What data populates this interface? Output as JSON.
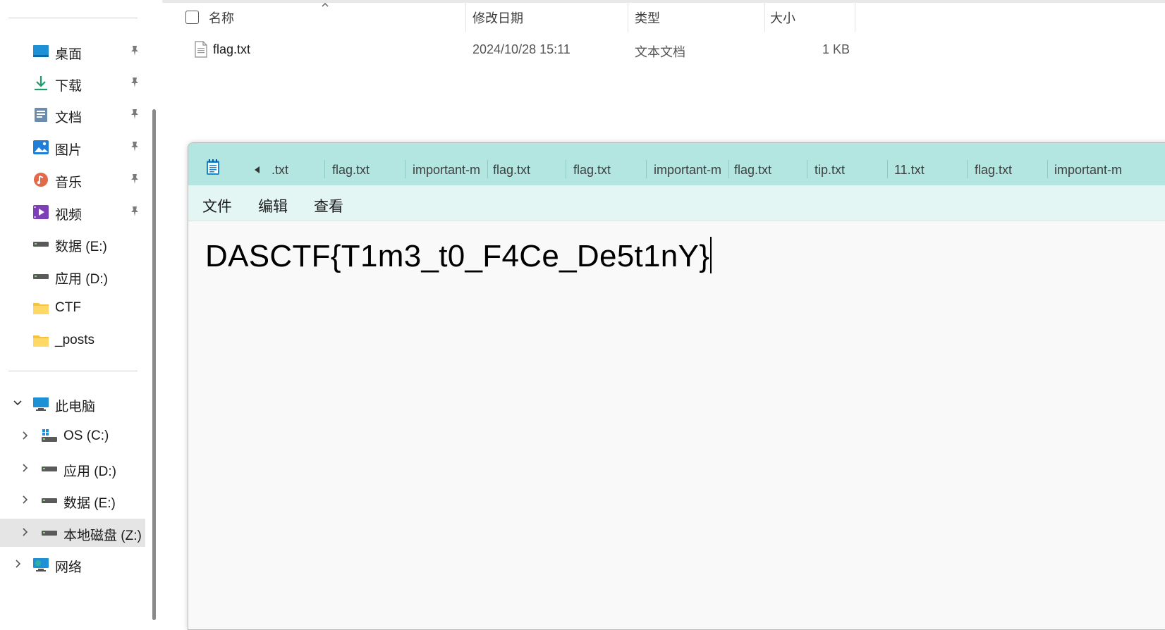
{
  "nav": {
    "quick_access": [
      {
        "label": "桌面",
        "icon": "desktop-icon"
      },
      {
        "label": "下载",
        "icon": "download-icon"
      },
      {
        "label": "文档",
        "icon": "documents-icon"
      },
      {
        "label": "图片",
        "icon": "pictures-icon"
      },
      {
        "label": "音乐",
        "icon": "music-icon"
      },
      {
        "label": "视频",
        "icon": "videos-icon"
      },
      {
        "label": "数据 (E:)",
        "icon": "drive-icon"
      },
      {
        "label": "应用 (D:)",
        "icon": "drive-icon"
      },
      {
        "label": "CTF",
        "icon": "folder-icon"
      },
      {
        "label": "_posts",
        "icon": "folder-icon"
      }
    ],
    "this_pc": {
      "label": "此电脑",
      "icon": "computer-icon"
    },
    "drives": [
      {
        "label": "OS (C:)",
        "icon": "windows-drive-icon"
      },
      {
        "label": "应用 (D:)",
        "icon": "drive-icon"
      },
      {
        "label": "数据 (E:)",
        "icon": "drive-icon"
      },
      {
        "label": "本地磁盘 (Z:)",
        "icon": "drive-icon",
        "selected": true
      }
    ],
    "network": {
      "label": "网络",
      "icon": "network-icon"
    }
  },
  "file_list": {
    "columns": {
      "name": "名称",
      "date": "修改日期",
      "type": "类型",
      "size": "大小"
    },
    "rows": [
      {
        "name": "flag.txt",
        "date": "2024/10/28 15:11",
        "type": "文本文档",
        "size": "1 KB"
      }
    ]
  },
  "notepad": {
    "tabs": [
      ".txt",
      "flag.txt",
      "important-m",
      "flag.txt",
      "flag.txt",
      "important-m",
      "flag.txt",
      "tip.txt",
      "11.txt",
      "flag.txt",
      "important-m"
    ],
    "menu": {
      "file": "文件",
      "edit": "编辑",
      "view": "查看"
    },
    "content": "DASCTF{T1m3_t0_F4Ce_De5t1nY}"
  },
  "colors": {
    "tabbar_bg": "#b3e6e1",
    "menubar_bg": "#e3f6f4",
    "editor_bg": "#f9f9f9",
    "selected_nav_bg": "#e5e5e5"
  }
}
